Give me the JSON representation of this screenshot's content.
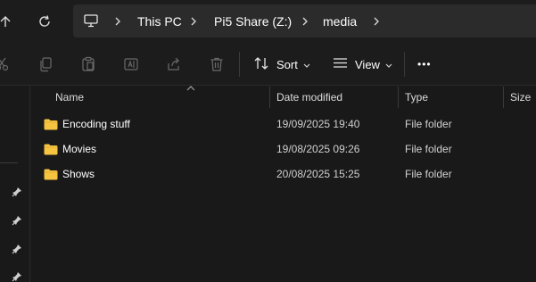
{
  "address": {
    "crumbs": [
      "This PC",
      "Pi5 Share (Z:)",
      "media"
    ]
  },
  "toolbar": {
    "sort_label": "Sort",
    "view_label": "View",
    "more_label": "•••"
  },
  "columns": {
    "name": "Name",
    "date": "Date modified",
    "type": "Type",
    "size": "Size"
  },
  "files": [
    {
      "name": "Encoding stuff",
      "date": "19/09/2025 19:40",
      "type": "File folder"
    },
    {
      "name": "Movies",
      "date": "19/08/2025 09:26",
      "type": "File folder"
    },
    {
      "name": "Shows",
      "date": "20/08/2025 15:25",
      "type": "File folder"
    }
  ],
  "colors": {
    "folder": "#f5c440",
    "background": "#191919",
    "address_bg": "#2b2b2b"
  },
  "icons": [
    "up-arrow-icon",
    "refresh-icon",
    "computer-icon",
    "cut-icon",
    "copy-icon",
    "paste-icon",
    "rename-icon",
    "share-icon",
    "delete-icon",
    "sort-icon",
    "view-icon",
    "pin-icon",
    "folder-icon"
  ]
}
